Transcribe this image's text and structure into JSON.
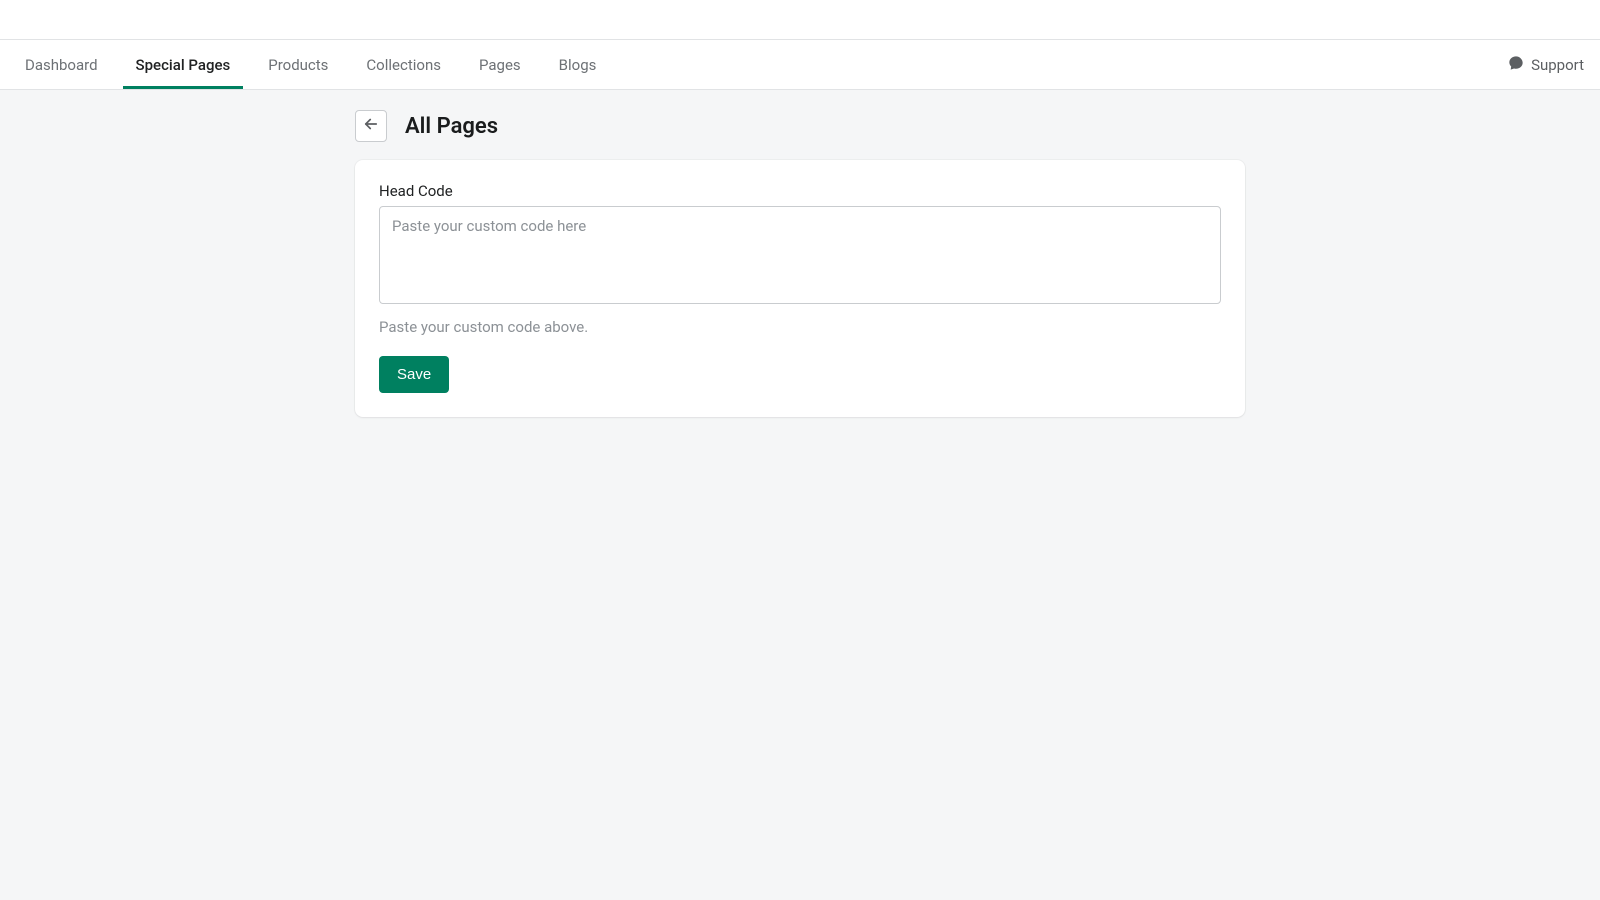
{
  "nav": {
    "tabs": [
      {
        "label": "Dashboard",
        "active": false
      },
      {
        "label": "Special Pages",
        "active": true
      },
      {
        "label": "Products",
        "active": false
      },
      {
        "label": "Collections",
        "active": false
      },
      {
        "label": "Pages",
        "active": false
      },
      {
        "label": "Blogs",
        "active": false
      }
    ],
    "support_label": "Support"
  },
  "header": {
    "title": "All Pages"
  },
  "form": {
    "head_code_label": "Head Code",
    "head_code_placeholder": "Paste your custom code here",
    "head_code_value": "",
    "head_code_help": "Paste your custom code above.",
    "save_label": "Save"
  },
  "colors": {
    "accent": "#008060"
  }
}
